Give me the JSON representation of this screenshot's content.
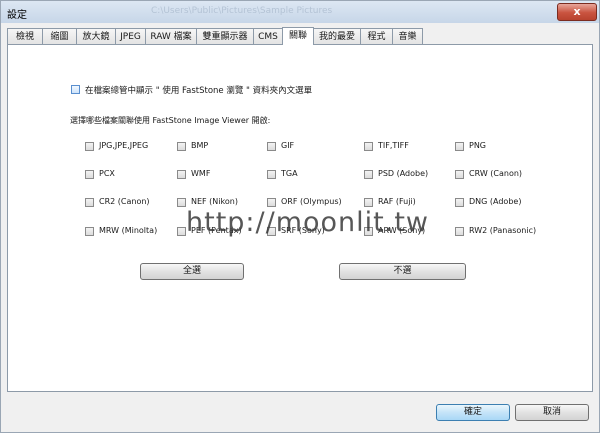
{
  "window": {
    "title": "設定",
    "background_caption": "C:\\Users\\Public\\Pictures\\Sample Pictures",
    "close_label": "x"
  },
  "tabs": [
    {
      "label": "檢視"
    },
    {
      "label": "縮圖"
    },
    {
      "label": "放大鏡"
    },
    {
      "label": "JPEG"
    },
    {
      "label": "RAW 檔案"
    },
    {
      "label": "雙重顯示器"
    },
    {
      "label": "CMS"
    },
    {
      "label": "關聯",
      "active": true
    },
    {
      "label": "我的最愛"
    },
    {
      "label": "程式"
    },
    {
      "label": "音樂"
    }
  ],
  "context_menu_option": {
    "label": "在檔案總管中顯示 \" 使用 FastStone 瀏覽 \" 資料夾內文選單",
    "checked": false
  },
  "associations": {
    "heading": "選擇哪些檔案關聯使用 FastStone Image Viewer 開啟:",
    "rows": [
      [
        "JPG,JPE,JPEG",
        "BMP",
        "GIF",
        "TIF,TIFF",
        "PNG"
      ],
      [
        "PCX",
        "WMF",
        "TGA",
        "PSD (Adobe)",
        "CRW (Canon)"
      ],
      [
        "CR2 (Canon)",
        "NEF (Nikon)",
        "ORF (Olympus)",
        "RAF (Fuji)",
        "DNG (Adobe)"
      ],
      [
        "MRW (Minolta)",
        "PEF (Pentax)",
        "SRF (Sony)",
        "ARW (Sony)",
        "RW2 (Panasonic)"
      ]
    ]
  },
  "buttons": {
    "select_all": "全選",
    "select_none": "不選",
    "ok": "確定",
    "cancel": "取消"
  },
  "watermark": "http://moonlit.tw"
}
